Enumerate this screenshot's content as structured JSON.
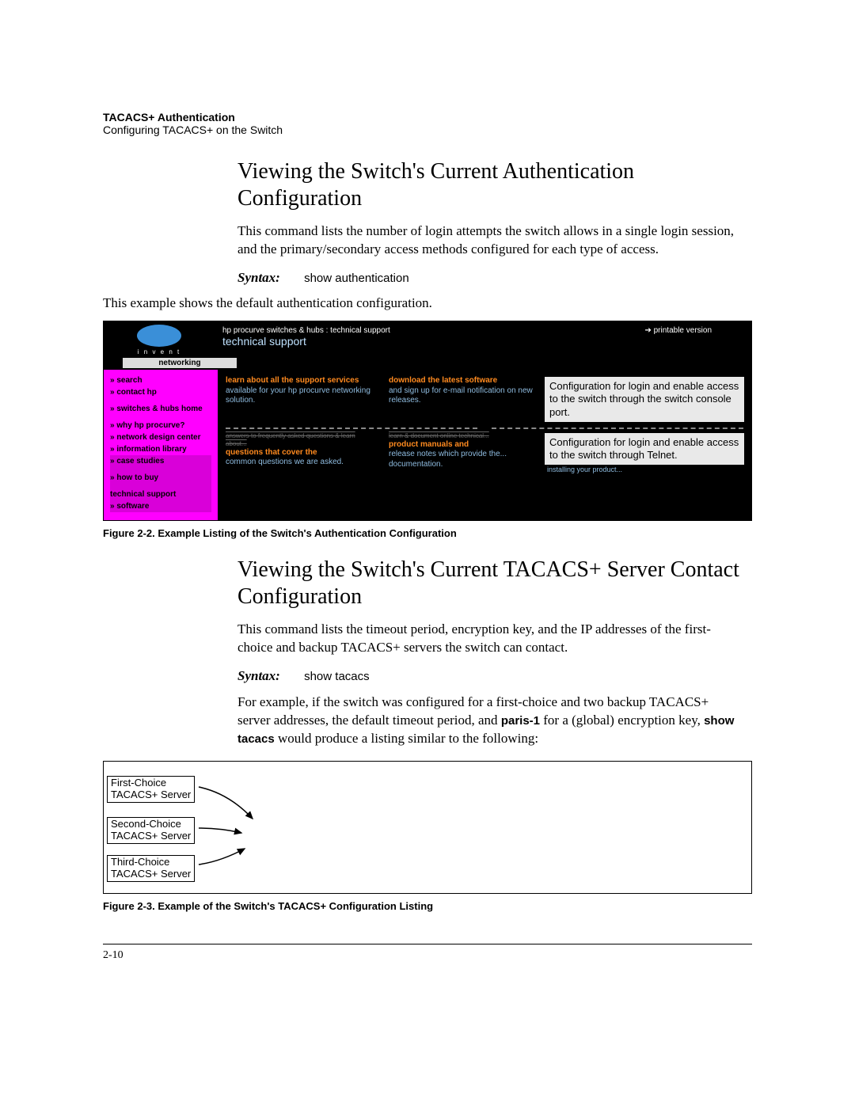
{
  "header": {
    "title": "TACACS+ Authentication",
    "subtitle": "Configuring TACACS+ on the Switch"
  },
  "section1": {
    "heading": "Viewing the Switch's Current Authentication Configuration",
    "paragraph": "This command lists the number of login attempts the switch allows in a single login session, and the primary/secondary access methods configured for each type of access.",
    "syntax_label": "Syntax:",
    "syntax_cmd": "show authentication",
    "example_intro": "This example shows the default authentication configuration."
  },
  "figure2_2": {
    "logo_sub": "i n v e n t",
    "crumb": "hp procurve switches & hubs : technical support",
    "title": "technical support",
    "printable": "printable version",
    "networking": "networking",
    "sidebar": [
      "» search",
      "» contact hp",
      "» switches & hubs home",
      "» why hp procurve?",
      "» network design center",
      "» information library",
      "» case studies",
      "» how to buy",
      "technical support",
      "» software"
    ],
    "cells": {
      "r1c1_link": "learn about all the support services",
      "r1c1_body": "available for your hp procurve networking solution.",
      "r1c2_link": "download the latest software",
      "r1c2_body": "and sign up for e-mail notification on new releases.",
      "r2c1_link": "questions that cover the",
      "r2c1_pre": "answers to frequently asked questions & learn about...",
      "r2c1_body": "common questions we are asked.",
      "r2c2_link": "product manuals and",
      "r2c2_pre": "learn & document online technical...",
      "r2c2_body": "release notes which provide the... documentation."
    },
    "callout1": "Configuration for login and enable access to the switch through the  switch console port.",
    "callout2": "Configuration for login and enable access to the switch through Telnet.",
    "callout2_under": "installing your product...",
    "caption": "Figure 2-2. Example Listing of the Switch's Authentication Configuration"
  },
  "section2": {
    "heading": "Viewing the Switch's Current TACACS+ Server Contact Configuration",
    "paragraph1": "This command lists the timeout period, encryption key, and the IP addresses of the first-choice and backup TACACS+ servers the switch can contact.",
    "syntax_label": "Syntax:",
    "syntax_cmd": "show tacacs",
    "paragraph2_a": "For example, if the switch was configured for a first-choice and two backup TACACS+ server addresses, the default timeout period, and ",
    "paragraph2_kw1": "paris-1",
    "paragraph2_b": " for a (global) encryption key, ",
    "paragraph2_kw2": "show tacacs",
    "paragraph2_c": " would produce a listing similar to the following:"
  },
  "figure2_3": {
    "label1a": "First-Choice",
    "label1b": "TACACS+ Server",
    "label2a": "Second-Choice",
    "label2b": "TACACS+ Server",
    "label3a": "Third-Choice",
    "label3b": "TACACS+ Server",
    "caption": "Figure 2-3. Example of the Switch's TACACS+ Configuration Listing"
  },
  "footer": {
    "page": "2-10"
  }
}
